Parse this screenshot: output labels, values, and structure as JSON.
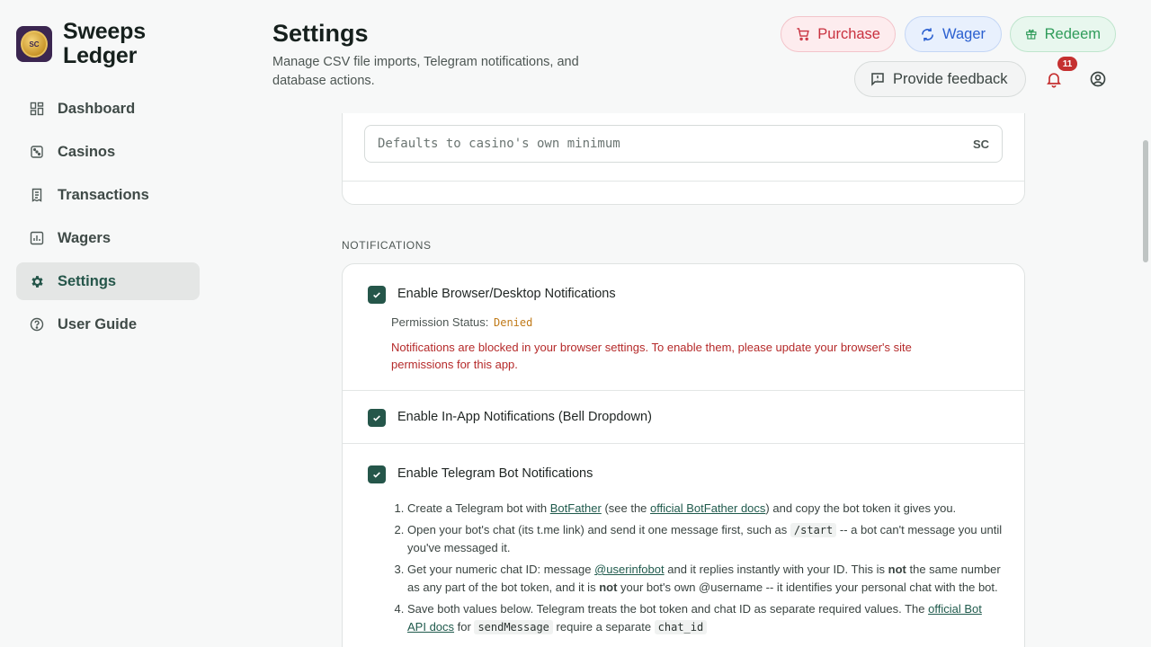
{
  "brand": {
    "name": "Sweeps Ledger",
    "logo_text": "SC"
  },
  "sidebar": {
    "items": [
      {
        "label": "Dashboard",
        "icon": "dashboard-icon"
      },
      {
        "label": "Casinos",
        "icon": "dice-icon"
      },
      {
        "label": "Transactions",
        "icon": "receipt-icon"
      },
      {
        "label": "Wagers",
        "icon": "chart-icon"
      },
      {
        "label": "Settings",
        "icon": "gear-icon",
        "active": true
      },
      {
        "label": "User Guide",
        "icon": "help-icon"
      }
    ]
  },
  "header": {
    "title": "Settings",
    "subtitle": "Manage CSV file imports, Telegram notifications, and database actions.",
    "purchase_label": "Purchase",
    "wager_label": "Wager",
    "redeem_label": "Redeem",
    "feedback_label": "Provide feedback",
    "notification_count": "11"
  },
  "min_input": {
    "placeholder": "Defaults to casino's own minimum",
    "suffix": "SC"
  },
  "notifications": {
    "section_label": "NOTIFICATIONS",
    "browser": {
      "label": "Enable Browser/Desktop Notifications",
      "checked": true,
      "permission_label": "Permission Status:",
      "permission_value": "Denied",
      "blocked_message": "Notifications are blocked in your browser settings. To enable them, please update your browser's site permissions for this app."
    },
    "in_app": {
      "label": "Enable In-App Notifications (Bell Dropdown)",
      "checked": true
    },
    "telegram": {
      "label": "Enable Telegram Bot Notifications",
      "checked": true,
      "steps": {
        "s1_a": "Create a Telegram bot with ",
        "s1_link1": "BotFather",
        "s1_b": " (see the ",
        "s1_link2": "official BotFather docs",
        "s1_c": ") and copy the bot token it gives you.",
        "s2_a": "Open your bot's chat (its t.me link) and send it one message first, such as ",
        "s2_code": "/start",
        "s2_b": " -- a bot can't message you until you've messaged it.",
        "s3_a": "Get your numeric chat ID: message ",
        "s3_link": "@userinfobot",
        "s3_b": " and it replies instantly with your ID. This is ",
        "s3_not1": "not",
        "s3_c": " the same number as any part of the bot token, and it is ",
        "s3_not2": "not",
        "s3_d": " your bot's own @username -- it identifies your personal chat with the bot.",
        "s4_a": "Save both values below. Telegram treats the bot token and chat ID as separate required values. The ",
        "s4_link": "official Bot API docs",
        "s4_b": " for ",
        "s4_code1": "sendMessage",
        "s4_c": " require a separate ",
        "s4_code2": "chat_id"
      }
    }
  },
  "colors": {
    "accent": "#25564a",
    "purchase": "#c9313f",
    "wager": "#2a5fd0",
    "redeem": "#2f9c5a",
    "denied": "#c07a18",
    "error": "#b52a2a",
    "badge": "#c53030"
  }
}
